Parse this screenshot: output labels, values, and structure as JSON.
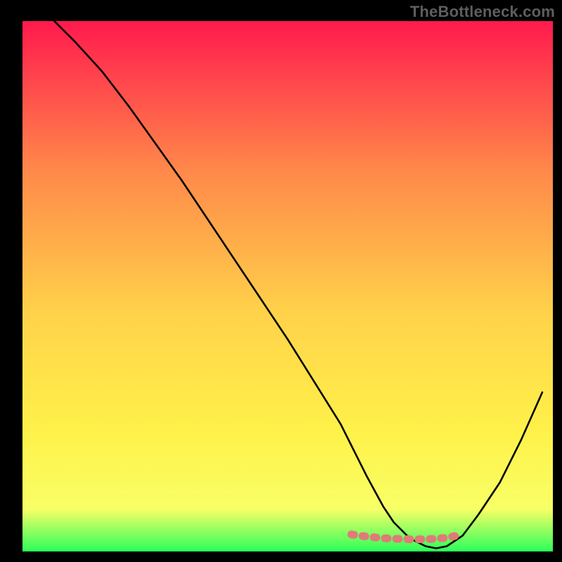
{
  "watermark": "TheBottleneck.com",
  "colors": {
    "background": "#000000",
    "gradient_top": "#ff1a4d",
    "gradient_upper_mid": "#ff884a",
    "gradient_mid": "#ffd24a",
    "gradient_lower_mid": "#fff24a",
    "gradient_near_bottom": "#f8ff66",
    "gradient_bottom": "#2cff5a",
    "curve": "#000000",
    "highlight": "#e07a78",
    "watermark": "#5e5e5e"
  },
  "chart_data": {
    "type": "line",
    "title": "",
    "xlabel": "",
    "ylabel": "",
    "xlim": [
      0,
      100
    ],
    "ylim": [
      0,
      100
    ],
    "annotations": [],
    "series": [
      {
        "name": "bottleneck-curve",
        "x": [
          6,
          10,
          15,
          20,
          25,
          30,
          35,
          40,
          45,
          50,
          55,
          60,
          62,
          65,
          68,
          70,
          73,
          76,
          78,
          80,
          83,
          86,
          90,
          94,
          98
        ],
        "y": [
          100,
          96,
          90.5,
          84,
          77,
          70,
          62.5,
          55,
          47.5,
          40,
          32,
          24,
          20,
          14,
          8.5,
          5.5,
          2.5,
          1,
          0.6,
          1,
          3,
          7,
          13,
          21,
          30
        ]
      }
    ],
    "highlight_segment": {
      "name": "optimal-range",
      "x": [
        62,
        65,
        68,
        70,
        73,
        76,
        78,
        80,
        83
      ],
      "y": [
        3.2,
        2.8,
        2.5,
        2.4,
        2.3,
        2.3,
        2.4,
        2.6,
        3.2
      ]
    }
  }
}
